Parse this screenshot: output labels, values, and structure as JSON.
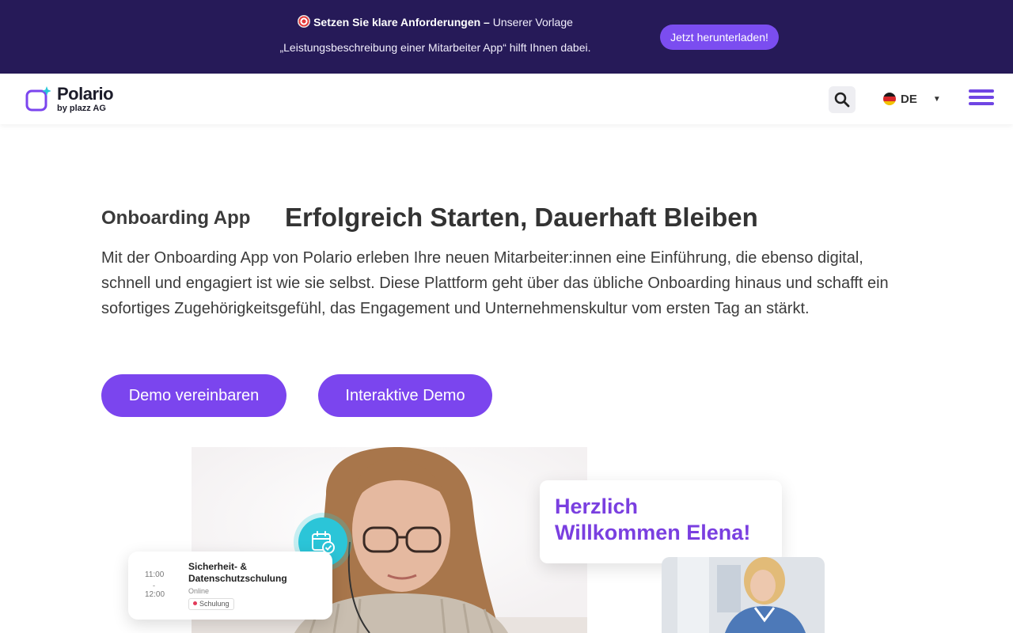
{
  "banner": {
    "headline_bold": "Setzen Sie klare Anforderungen –",
    "headline_rest": " Unserer Vorlage",
    "line2": "„Leistungsbeschreibung einer Mitarbeiter App“ hilft Ihnen dabei.",
    "cta_label": "Jetzt herunterladen!",
    "bg_color": "#261a58",
    "cta_color": "#7b4df0",
    "icon": "target-icon"
  },
  "header": {
    "logo_name": "Polario",
    "logo_sub": "by plazz AG",
    "language": "DE",
    "icons": [
      "search-icon",
      "germany-flag-icon",
      "caret-down-icon",
      "hamburger-menu-icon"
    ],
    "accent_color": "#6f45e3"
  },
  "hero": {
    "eyebrow": "Onboarding App",
    "title": "Erfolgreich Starten, Dauerhaft Bleiben",
    "text": "Mit der Onboarding App von Polario erleben Ihre neuen Mitarbeiter:innen eine Einführung, die ebenso digital, schnell und engagiert ist wie sie selbst. Diese Plattform geht über das übliche Onboarding hinaus und schafft ein sofortiges Zugehörigkeitsgefühl, das Engagement und Unternehmenskultur vom ersten Tag an stärkt.",
    "buttons": {
      "demo": "Demo vereinbaren",
      "interactive": "Interaktive Demo"
    },
    "button_color": "#7b45ee"
  },
  "illustration": {
    "schedule_card": {
      "time_start": "11:00",
      "time_sep": "-",
      "time_end": "12:00",
      "title": "Sicherheit- & Datenschutzschulung",
      "mode": "Online",
      "tag": "Schulung"
    },
    "welcome_card": {
      "line1": "Herzlich",
      "line2": "Willkommen Elena!"
    },
    "icons": [
      "calendar-check-icon"
    ]
  }
}
